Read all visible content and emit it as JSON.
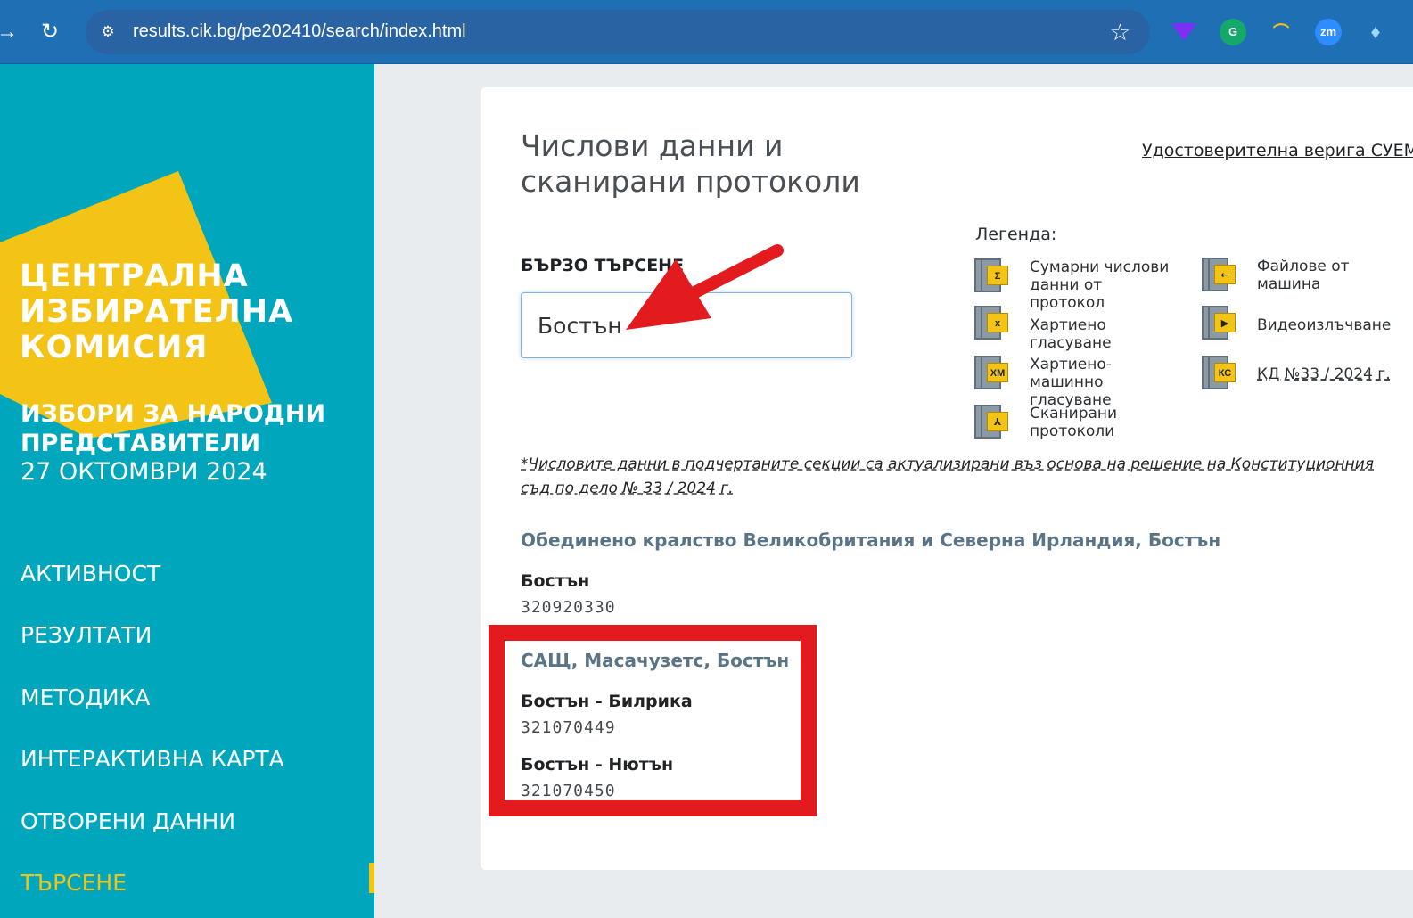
{
  "browser": {
    "url": "results.cik.bg/pe202410/search/index.html",
    "extensions": [
      "vpn-extension-icon",
      "grammarly-icon",
      "misc-extension-icon",
      "zoom-extension-icon",
      "pin-extension-icon"
    ],
    "zoom_ext_label": "zm"
  },
  "sidebar": {
    "logo_lines": [
      "ЦЕНТРАЛНА",
      "ИЗБИРАТЕЛНА",
      "КОМИСИЯ"
    ],
    "election_title_line1": "ИЗБОРИ ЗА НАРОДНИ",
    "election_title_line2": "ПРЕДСТАВИТЕЛИ",
    "election_date": "27 ОКТОМВРИ 2024",
    "nav": [
      "АКТИВНОСТ",
      "РЕЗУЛТАТИ",
      "МЕТОДИКА",
      "ИНТЕРАКТИВНА КАРТА",
      "ОТВОРЕНИ ДАННИ",
      "ТЪРСЕНЕ"
    ],
    "active_index": 5,
    "colors": {
      "background": "#00a7bc",
      "logo_yellow": "#f3c316"
    }
  },
  "main": {
    "title": "Числови данни и сканирани протоколи",
    "chain_link": "Удостоверителна верига СУЕМГ",
    "quick_search_label": "БЪРЗО ТЪРСЕНЕ",
    "search_value": "Бостън",
    "legend_title": "Легенда:",
    "legend": [
      {
        "badge": "Σ",
        "label": "Сумарни числови данни от протокол"
      },
      {
        "badge": "x",
        "label": "Хартиено гласуване"
      },
      {
        "badge": "ХМ",
        "label": "Хартиено-машинно гласуване"
      },
      {
        "badge": "⅄",
        "label": "Сканирани протоколи"
      },
      {
        "badge": "⇠",
        "label": "Файлове от машина"
      },
      {
        "badge": "▶",
        "label": "Видеоизлъчване"
      },
      {
        "badge": "КС",
        "label": "КД №33 / 2024 г."
      }
    ],
    "note": "*Числовите данни в подчертаните секции са актуализирани въз основа на решение на Конституционния съд по дело № 33 / 2024 г.",
    "results": [
      {
        "heading": "Обединено кралство Великобритания и Северна Ирландия, Бостън",
        "sections": [
          {
            "name": "Бостън",
            "code": "320920330"
          }
        ]
      },
      {
        "heading": "САЩ, Масачузетс, Бостън",
        "sections": [
          {
            "name": "Бостън - Билрика",
            "code": "321070449"
          },
          {
            "name": "Бостън - Нютън",
            "code": "321070450"
          }
        ]
      }
    ],
    "annotation_color": "#e31b1f"
  }
}
